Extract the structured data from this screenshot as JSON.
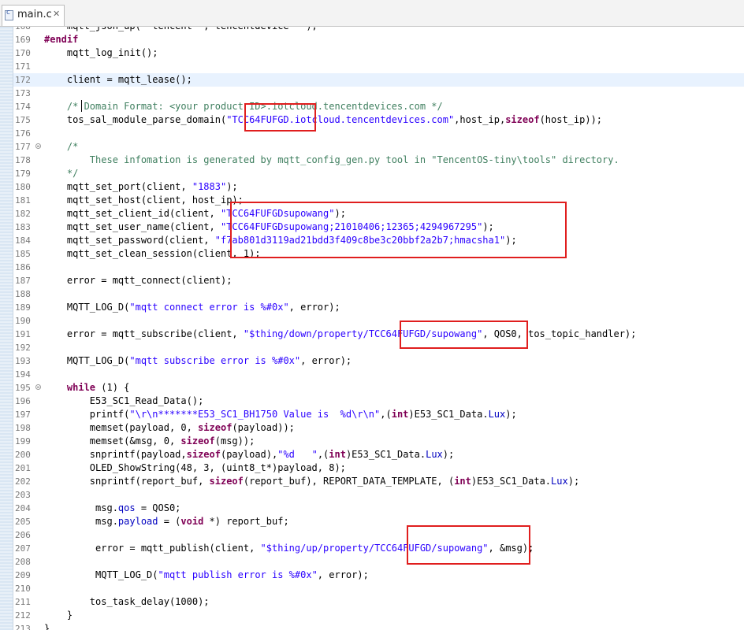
{
  "tab": {
    "label": "main.c",
    "close": "✕"
  },
  "gutter_markers": {
    "warning_glyph": "⚙"
  },
  "lines": [
    {
      "n": "168",
      "code": [
        {
          "t": "    mqtt_json_up( \"tencent\" , tencentdevice\"\" );",
          "c": ""
        }
      ],
      "fold": false,
      "current": false
    },
    {
      "n": "169",
      "code": [
        {
          "t": "#endif",
          "c": "pp"
        }
      ],
      "fold": false,
      "current": false
    },
    {
      "n": "170",
      "code": [
        {
          "t": "    mqtt_log_init();",
          "c": ""
        }
      ],
      "fold": false,
      "current": false
    },
    {
      "n": "171",
      "code": [],
      "fold": false,
      "current": false
    },
    {
      "n": "172",
      "code": [
        {
          "t": "    client = mqtt_lease();",
          "c": ""
        }
      ],
      "fold": false,
      "current": true
    },
    {
      "n": "173",
      "code": [],
      "fold": false,
      "current": false
    },
    {
      "n": "174",
      "code": [
        {
          "t": "    /* Domain Format: <your product ID>.iotcloud.tencentdevices.com */",
          "c": "cmt"
        }
      ],
      "fold": false,
      "current": false
    },
    {
      "n": "175",
      "code": [
        {
          "t": "    tos_sal_module_parse_domain(",
          "c": ""
        },
        {
          "t": "\"TCC64FUFGD.iotcloud.tencentdevices.com\"",
          "c": "str"
        },
        {
          "t": ",host_ip,",
          "c": ""
        },
        {
          "t": "sizeof",
          "c": "kw"
        },
        {
          "t": "(host_ip));",
          "c": ""
        }
      ],
      "fold": false,
      "current": false
    },
    {
      "n": "176",
      "code": [],
      "fold": false,
      "current": false
    },
    {
      "n": "177",
      "code": [
        {
          "t": "    /*",
          "c": "cmt"
        }
      ],
      "fold": true,
      "current": false
    },
    {
      "n": "178",
      "code": [
        {
          "t": "        These infomation is generated by mqtt_config_gen.py tool in \"TencentOS-tiny\\tools\" directory.",
          "c": "cmt"
        }
      ],
      "fold": false,
      "current": false
    },
    {
      "n": "179",
      "code": [
        {
          "t": "    */",
          "c": "cmt"
        }
      ],
      "fold": false,
      "current": false
    },
    {
      "n": "180",
      "code": [
        {
          "t": "    mqtt_set_port(client, ",
          "c": ""
        },
        {
          "t": "\"1883\"",
          "c": "str"
        },
        {
          "t": ");",
          "c": ""
        }
      ],
      "fold": false,
      "current": false
    },
    {
      "n": "181",
      "code": [
        {
          "t": "    mqtt_set_host(client, host_ip);",
          "c": ""
        }
      ],
      "fold": false,
      "current": false
    },
    {
      "n": "182",
      "code": [
        {
          "t": "    mqtt_set_client_id(client, ",
          "c": ""
        },
        {
          "t": "\"TCC64FUFGDsupowang\"",
          "c": "str"
        },
        {
          "t": ");",
          "c": ""
        }
      ],
      "fold": false,
      "current": false
    },
    {
      "n": "183",
      "code": [
        {
          "t": "    mqtt_set_user_name(client, ",
          "c": ""
        },
        {
          "t": "\"TCC64FUFGDsupowang;21010406;12365;4294967295\"",
          "c": "str"
        },
        {
          "t": ");",
          "c": ""
        }
      ],
      "fold": false,
      "current": false
    },
    {
      "n": "184",
      "code": [
        {
          "t": "    mqtt_set_password(client, ",
          "c": ""
        },
        {
          "t": "\"f7ab801d3119ad21bdd3f409c8be3c20bbf2a2b7;hmacsha1\"",
          "c": "str"
        },
        {
          "t": ");",
          "c": ""
        }
      ],
      "fold": false,
      "current": false
    },
    {
      "n": "185",
      "code": [
        {
          "t": "    mqtt_set_clean_session(client, 1);",
          "c": ""
        }
      ],
      "fold": false,
      "current": false
    },
    {
      "n": "186",
      "code": [],
      "fold": false,
      "current": false
    },
    {
      "n": "187",
      "code": [
        {
          "t": "    error = mqtt_connect(client);",
          "c": ""
        }
      ],
      "fold": false,
      "current": false
    },
    {
      "n": "188",
      "code": [],
      "fold": false,
      "current": false
    },
    {
      "n": "189",
      "code": [
        {
          "t": "    MQTT_LOG_D(",
          "c": ""
        },
        {
          "t": "\"mqtt connect error is %#0x\"",
          "c": "str"
        },
        {
          "t": ", error);",
          "c": ""
        }
      ],
      "fold": false,
      "current": false
    },
    {
      "n": "190",
      "code": [],
      "fold": false,
      "current": false
    },
    {
      "n": "191",
      "code": [
        {
          "t": "    error = mqtt_subscribe(client, ",
          "c": ""
        },
        {
          "t": "\"$thing/down/property/TCC64FUFGD/supowang\"",
          "c": "str"
        },
        {
          "t": ", QOS0, tos_topic_handler);",
          "c": ""
        }
      ],
      "fold": false,
      "current": false,
      "marker": true
    },
    {
      "n": "192",
      "code": [],
      "fold": false,
      "current": false
    },
    {
      "n": "193",
      "code": [
        {
          "t": "    MQTT_LOG_D(",
          "c": ""
        },
        {
          "t": "\"mqtt subscribe error is %#0x\"",
          "c": "str"
        },
        {
          "t": ", error);",
          "c": ""
        }
      ],
      "fold": false,
      "current": false
    },
    {
      "n": "194",
      "code": [],
      "fold": false,
      "current": false
    },
    {
      "n": "195",
      "code": [
        {
          "t": "    ",
          "c": ""
        },
        {
          "t": "while",
          "c": "kw"
        },
        {
          "t": " (1) {",
          "c": ""
        }
      ],
      "fold": true,
      "current": false
    },
    {
      "n": "196",
      "code": [
        {
          "t": "        E53_SC1_Read_Data();",
          "c": ""
        }
      ],
      "fold": false,
      "current": false
    },
    {
      "n": "197",
      "code": [
        {
          "t": "        printf(",
          "c": ""
        },
        {
          "t": "\"\\r\\n*******E53_SC1_BH1750 Value is  %d\\r\\n\"",
          "c": "str"
        },
        {
          "t": ",(",
          "c": ""
        },
        {
          "t": "int",
          "c": "kw"
        },
        {
          "t": ")E53_SC1_Data.",
          "c": ""
        },
        {
          "t": "Lux",
          "c": "fld"
        },
        {
          "t": ");",
          "c": ""
        }
      ],
      "fold": false,
      "current": false
    },
    {
      "n": "198",
      "code": [
        {
          "t": "        memset(payload, 0, ",
          "c": ""
        },
        {
          "t": "sizeof",
          "c": "kw"
        },
        {
          "t": "(payload));",
          "c": ""
        }
      ],
      "fold": false,
      "current": false
    },
    {
      "n": "199",
      "code": [
        {
          "t": "        memset(&msg, 0, ",
          "c": ""
        },
        {
          "t": "sizeof",
          "c": "kw"
        },
        {
          "t": "(msg));",
          "c": ""
        }
      ],
      "fold": false,
      "current": false
    },
    {
      "n": "200",
      "code": [
        {
          "t": "        snprintf(payload,",
          "c": ""
        },
        {
          "t": "sizeof",
          "c": "kw"
        },
        {
          "t": "(payload),",
          "c": ""
        },
        {
          "t": "\"%d   \"",
          "c": "str"
        },
        {
          "t": ",(",
          "c": ""
        },
        {
          "t": "int",
          "c": "kw"
        },
        {
          "t": ")E53_SC1_Data.",
          "c": ""
        },
        {
          "t": "Lux",
          "c": "fld"
        },
        {
          "t": ");",
          "c": ""
        }
      ],
      "fold": false,
      "current": false
    },
    {
      "n": "201",
      "code": [
        {
          "t": "        OLED_ShowString(48, 3, (uint8_t*)payload, 8);",
          "c": ""
        }
      ],
      "fold": false,
      "current": false
    },
    {
      "n": "202",
      "code": [
        {
          "t": "        snprintf(report_buf, ",
          "c": ""
        },
        {
          "t": "sizeof",
          "c": "kw"
        },
        {
          "t": "(report_buf), REPORT_DATA_TEMPLATE, (",
          "c": ""
        },
        {
          "t": "int",
          "c": "kw"
        },
        {
          "t": ")E53_SC1_Data.",
          "c": ""
        },
        {
          "t": "Lux",
          "c": "fld"
        },
        {
          "t": ");",
          "c": ""
        }
      ],
      "fold": false,
      "current": false
    },
    {
      "n": "203",
      "code": [],
      "fold": false,
      "current": false
    },
    {
      "n": "204",
      "code": [
        {
          "t": "         msg.",
          "c": ""
        },
        {
          "t": "qos",
          "c": "fld"
        },
        {
          "t": " = QOS0;",
          "c": ""
        }
      ],
      "fold": false,
      "current": false,
      "marker": true
    },
    {
      "n": "205",
      "code": [
        {
          "t": "         msg.",
          "c": ""
        },
        {
          "t": "payload",
          "c": "fld"
        },
        {
          "t": " = (",
          "c": ""
        },
        {
          "t": "void",
          "c": "kw"
        },
        {
          "t": " *) report_buf;",
          "c": ""
        }
      ],
      "fold": false,
      "current": false
    },
    {
      "n": "206",
      "code": [],
      "fold": false,
      "current": false
    },
    {
      "n": "207",
      "code": [
        {
          "t": "         error = mqtt_publish(client, ",
          "c": ""
        },
        {
          "t": "\"$thing/up/property/TCC64FUFGD/supowang\"",
          "c": "str"
        },
        {
          "t": ", &msg);",
          "c": ""
        }
      ],
      "fold": false,
      "current": false
    },
    {
      "n": "208",
      "code": [],
      "fold": false,
      "current": false
    },
    {
      "n": "209",
      "code": [
        {
          "t": "         MQTT_LOG_D(",
          "c": ""
        },
        {
          "t": "\"mqtt publish error is %#0x\"",
          "c": "str"
        },
        {
          "t": ", error);",
          "c": ""
        }
      ],
      "fold": false,
      "current": false
    },
    {
      "n": "210",
      "code": [],
      "fold": false,
      "current": false
    },
    {
      "n": "211",
      "code": [
        {
          "t": "        tos_task_delay(1000);",
          "c": ""
        }
      ],
      "fold": false,
      "current": false
    },
    {
      "n": "212",
      "code": [
        {
          "t": "    }",
          "c": ""
        }
      ],
      "fold": false,
      "current": false
    },
    {
      "n": "213",
      "code": [
        {
          "t": "}",
          "c": ""
        }
      ],
      "fold": false,
      "current": false
    }
  ],
  "colors": {
    "highlight_box": "#e01e1e",
    "keyword": "#7f0055",
    "comment": "#3f7f5f",
    "string": "#2a00ff",
    "field": "#0000c0"
  }
}
